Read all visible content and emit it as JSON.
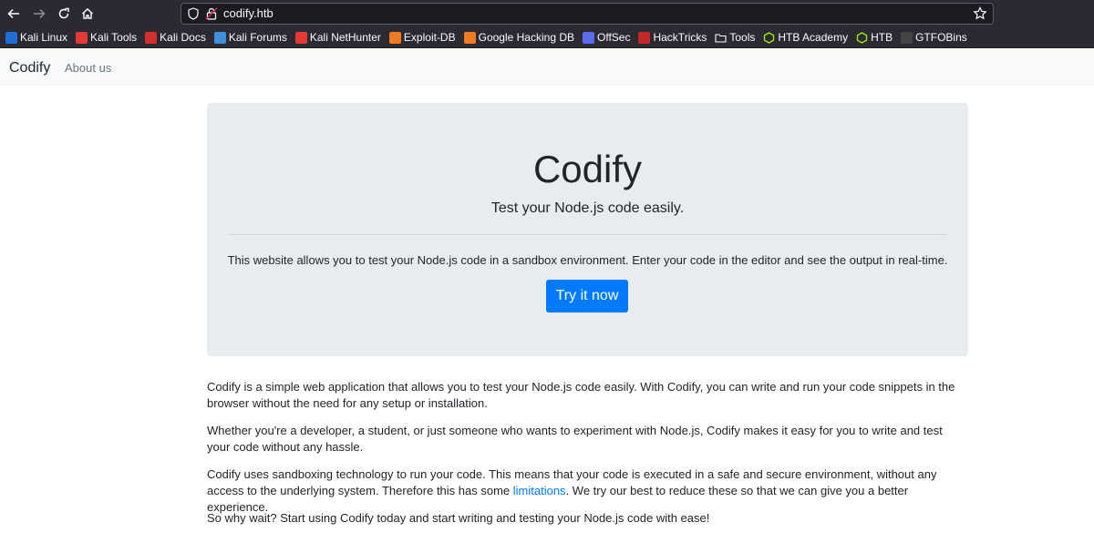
{
  "browser": {
    "url": "codify.htb",
    "nav_icons": [
      "back-icon",
      "forward-icon",
      "reload-icon",
      "home-icon"
    ],
    "bookmarks": [
      {
        "label": "Kali Linux",
        "icon": "kali-icon",
        "color": "#1f6ed4"
      },
      {
        "label": "Kali Tools",
        "icon": "kali-tools-icon",
        "color": "#e53935"
      },
      {
        "label": "Kali Docs",
        "icon": "kali-docs-icon",
        "color": "#d32f2f"
      },
      {
        "label": "Kali Forums",
        "icon": "kali-forums-icon",
        "color": "#3f8fdc"
      },
      {
        "label": "Kali NetHunter",
        "icon": "nethunter-icon",
        "color": "#e53935"
      },
      {
        "label": "Exploit-DB",
        "icon": "exploitdb-icon",
        "color": "#f07b21"
      },
      {
        "label": "Google Hacking DB",
        "icon": "ghdb-icon",
        "color": "#f07b21"
      },
      {
        "label": "OffSec",
        "icon": "offsec-icon",
        "color": "#5b6cf0"
      },
      {
        "label": "HackTricks",
        "icon": "hacktricks-icon",
        "color": "#c62828"
      },
      {
        "label": "Tools",
        "icon": "folder-icon",
        "color": "#fbfbfe"
      },
      {
        "label": "HTB Academy",
        "icon": "htb-academy-icon",
        "color": "#9fef00"
      },
      {
        "label": "HTB",
        "icon": "htb-icon",
        "color": "#9fef00"
      },
      {
        "label": "GTFOBins",
        "icon": "gtfobins-icon",
        "color": "#444444"
      }
    ]
  },
  "site": {
    "brand": "Codify",
    "nav_about": "About us",
    "hero": {
      "title": "Codify",
      "lead": "Test your Node.js code easily.",
      "text": "This website allows you to test your Node.js code in a sandbox environment. Enter your code in the editor and see the output in real-time.",
      "button": "Try it now"
    },
    "paragraphs": {
      "p1": "Codify is a simple web application that allows you to test your Node.js code easily. With Codify, you can write and run your code snippets in the browser without the need for any setup or installation.",
      "p2": "Whether you're a developer, a student, or just someone who wants to experiment with Node.js, Codify makes it easy for you to write and test your code without any hassle.",
      "p3_before": "Codify uses sandboxing technology to run your code. This means that your code is executed in a safe and secure environment, without any access to the underlying system. Therefore this has some ",
      "p3_link": "limitations",
      "p3_after": ". We try our best to reduce these so that we can give you a better experience.",
      "p4": "So why wait? Start using Codify today and start writing and testing your Node.js code with ease!"
    },
    "colors": {
      "primary": "#007bff",
      "jumbotron_bg": "#e9ecef",
      "navbar_bg": "#f8f9fa"
    }
  }
}
